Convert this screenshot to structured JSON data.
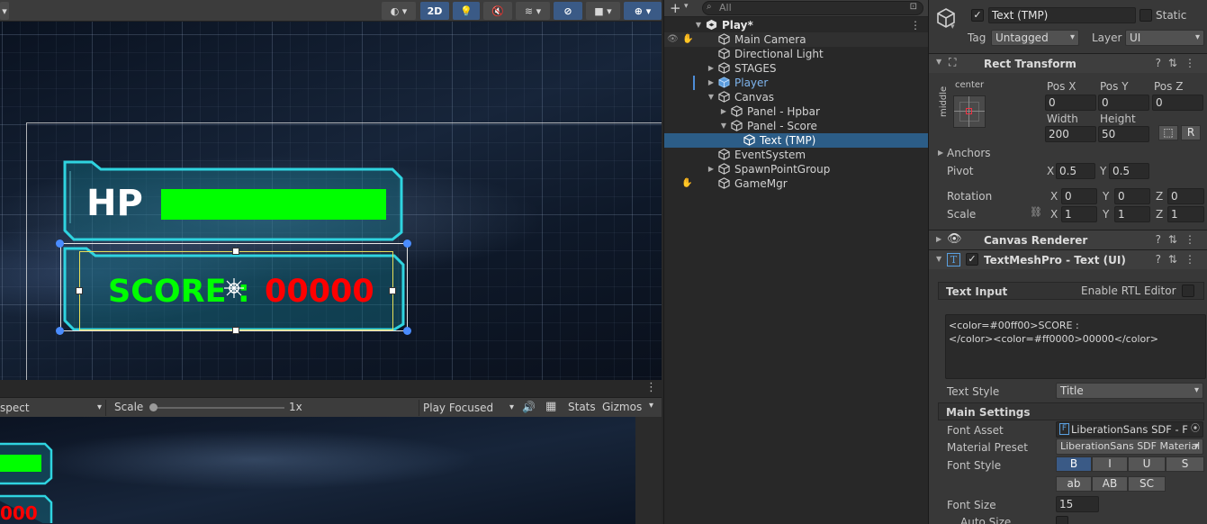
{
  "scene_toolbar": {
    "mode_2d": "2D"
  },
  "scene_ui": {
    "hp_label": "HP",
    "score_label": "SCORE :",
    "score_value": "00000",
    "hp_fill": 1.0,
    "colors": {
      "green": "#00ff00",
      "red": "#ff0000",
      "frame": "#2fd4e0"
    }
  },
  "game_toolbar": {
    "aspect": "spect",
    "scale_label": "Scale",
    "scale_value": "1x",
    "play_mode": "Play Focused",
    "stats": "Stats",
    "gizmos": "Gizmos"
  },
  "game_ui": {
    "score_value": "000"
  },
  "hierarchy": {
    "search_placeholder": "All",
    "items": [
      {
        "label": "Play*",
        "depth": 0,
        "expanded": true,
        "root": true
      },
      {
        "label": "Main Camera",
        "depth": 1
      },
      {
        "label": "Directional Light",
        "depth": 1
      },
      {
        "label": "STAGES",
        "depth": 1,
        "collapsed": true
      },
      {
        "label": "Player",
        "depth": 1,
        "collapsed": true,
        "prefab": true
      },
      {
        "label": "Canvas",
        "depth": 1,
        "expanded": true
      },
      {
        "label": "Panel - Hpbar",
        "depth": 2,
        "collapsed": true
      },
      {
        "label": "Panel - Score",
        "depth": 2,
        "expanded": true
      },
      {
        "label": "Text (TMP)",
        "depth": 3,
        "selected": true
      },
      {
        "label": "EventSystem",
        "depth": 1
      },
      {
        "label": "SpawnPointGroup",
        "depth": 1,
        "collapsed": true
      },
      {
        "label": "GameMgr",
        "depth": 1
      }
    ]
  },
  "inspector": {
    "object_name": "Text (TMP)",
    "static_label": "Static",
    "tag_label": "Tag",
    "tag_value": "Untagged",
    "layer_label": "Layer",
    "layer_value": "UI",
    "rect_transform": {
      "title": "Rect Transform",
      "anchor_h": "center",
      "anchor_v": "middle",
      "pos_x_label": "Pos X",
      "pos_y_label": "Pos Y",
      "pos_z_label": "Pos Z",
      "pos_x": "0",
      "pos_y": "0",
      "pos_z": "0",
      "width_label": "Width",
      "height_label": "Height",
      "width": "200",
      "height": "50",
      "r_button": "R",
      "anchors_label": "Anchors",
      "pivot_label": "Pivot",
      "pivot_x": "0.5",
      "pivot_y": "0.5",
      "rotation_label": "Rotation",
      "rot_x": "0",
      "rot_y": "0",
      "rot_z": "0",
      "scale_label": "Scale",
      "scale_x": "1",
      "scale_y": "1",
      "scale_z": "1",
      "x": "X",
      "y": "Y",
      "z": "Z"
    },
    "canvas_renderer": {
      "title": "Canvas Renderer"
    },
    "tmp": {
      "title": "TextMeshPro - Text (UI)",
      "text_input_label": "Text Input",
      "enable_rtl": "Enable RTL Editor",
      "text_line1": "<color=#00ff00>SCORE :",
      "text_line2": "</color><color=#ff0000>00000</color>",
      "text_style_label": "Text Style",
      "text_style_value": "Title",
      "main_settings": "Main Settings",
      "font_asset_label": "Font Asset",
      "font_asset_value": "LiberationSans SDF - F",
      "material_preset_label": "Material Preset",
      "material_preset_value": "LiberationSans SDF Material",
      "font_style_label": "Font Style",
      "style_buttons": [
        "B",
        "I",
        "U",
        "S"
      ],
      "case_buttons": [
        "ab",
        "AB",
        "SC"
      ],
      "font_size_label": "Font Size",
      "font_size_value": "15",
      "auto_size_label": "Auto Size"
    }
  }
}
